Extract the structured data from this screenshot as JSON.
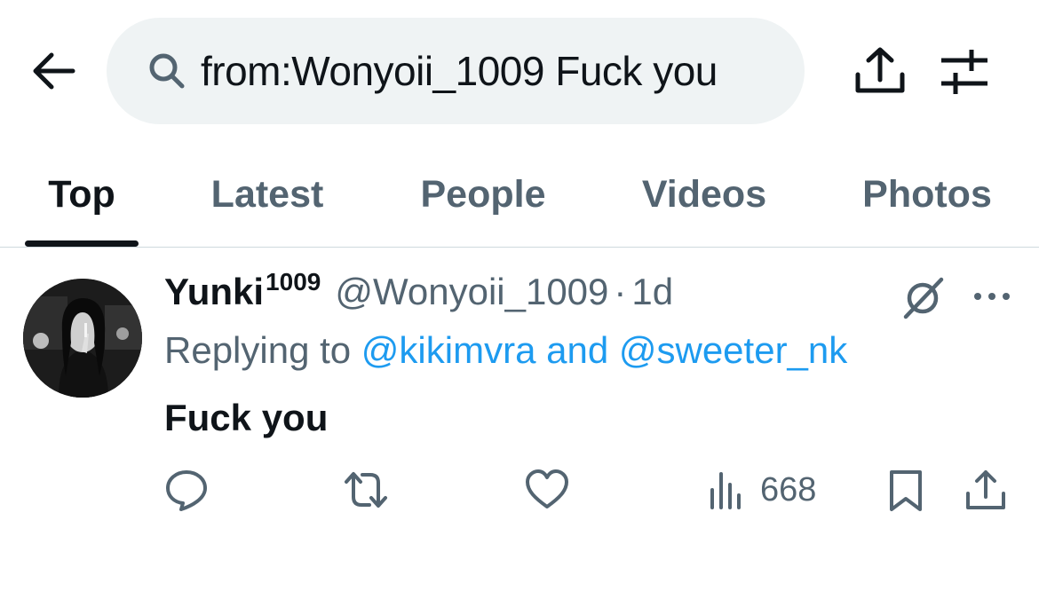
{
  "search": {
    "query": "from:Wonyoii_1009 Fuck you"
  },
  "tabs": [
    {
      "label": "Top",
      "active": true
    },
    {
      "label": "Latest",
      "active": false
    },
    {
      "label": "People",
      "active": false
    },
    {
      "label": "Videos",
      "active": false
    },
    {
      "label": "Photos",
      "active": false
    }
  ],
  "tweet": {
    "display_name": "Yunki",
    "display_name_superscript": "1009",
    "handle": "@Wonyoii_1009",
    "separator": "·",
    "time": "1d",
    "replying_prefix": "Replying to",
    "mention_1": "@kikimvra",
    "mention_joiner": "and",
    "mention_2": "@sweeter_nk",
    "text": "Fuck you",
    "views": "668"
  },
  "colors": {
    "accent": "#1d9bf0",
    "text_primary": "#0f1419",
    "text_secondary": "#536471",
    "search_bg": "#eff3f4",
    "divider": "#cfd9de"
  },
  "icons": {
    "back": "arrow-left-icon",
    "search": "search-icon",
    "share": "share-icon",
    "filter": "sliders-icon",
    "grok": "grok-icon",
    "more": "more-dots-icon",
    "reply": "reply-icon",
    "retweet": "retweet-icon",
    "like": "heart-icon",
    "views": "views-icon",
    "bookmark": "bookmark-icon"
  }
}
